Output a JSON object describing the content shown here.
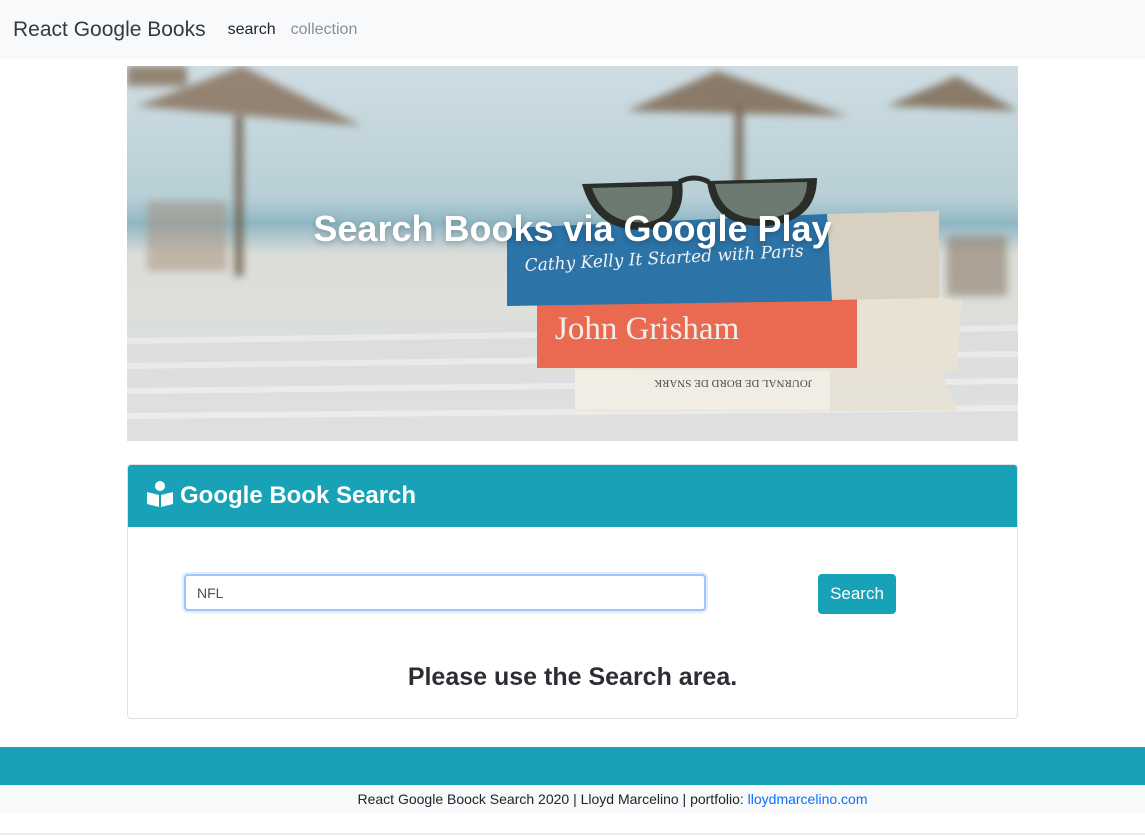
{
  "navbar": {
    "brand": "React Google Books",
    "links": [
      {
        "label": "search",
        "active": true
      },
      {
        "label": "collection",
        "active": false
      }
    ]
  },
  "hero": {
    "title": "Search Books via Google Play",
    "books": [
      "Cathy Kelly  It Started with Paris",
      "John Grisham",
      "JOURNAL DE BORD DE SNARK"
    ]
  },
  "search_card": {
    "header_icon": "open-book-reader-icon",
    "title": "Google Book Search",
    "input_value": "NFL",
    "button_label": "Search",
    "message": "Please use the Search area."
  },
  "footer": {
    "text": "React Google Boock Search 2020 | Lloyd Marcelino | portfolio: ",
    "link_text": "lloydmarcelino.com"
  },
  "colors": {
    "accent": "#17a2b8",
    "navbar_bg": "#f8f9fa",
    "link": "#0d6efd"
  }
}
